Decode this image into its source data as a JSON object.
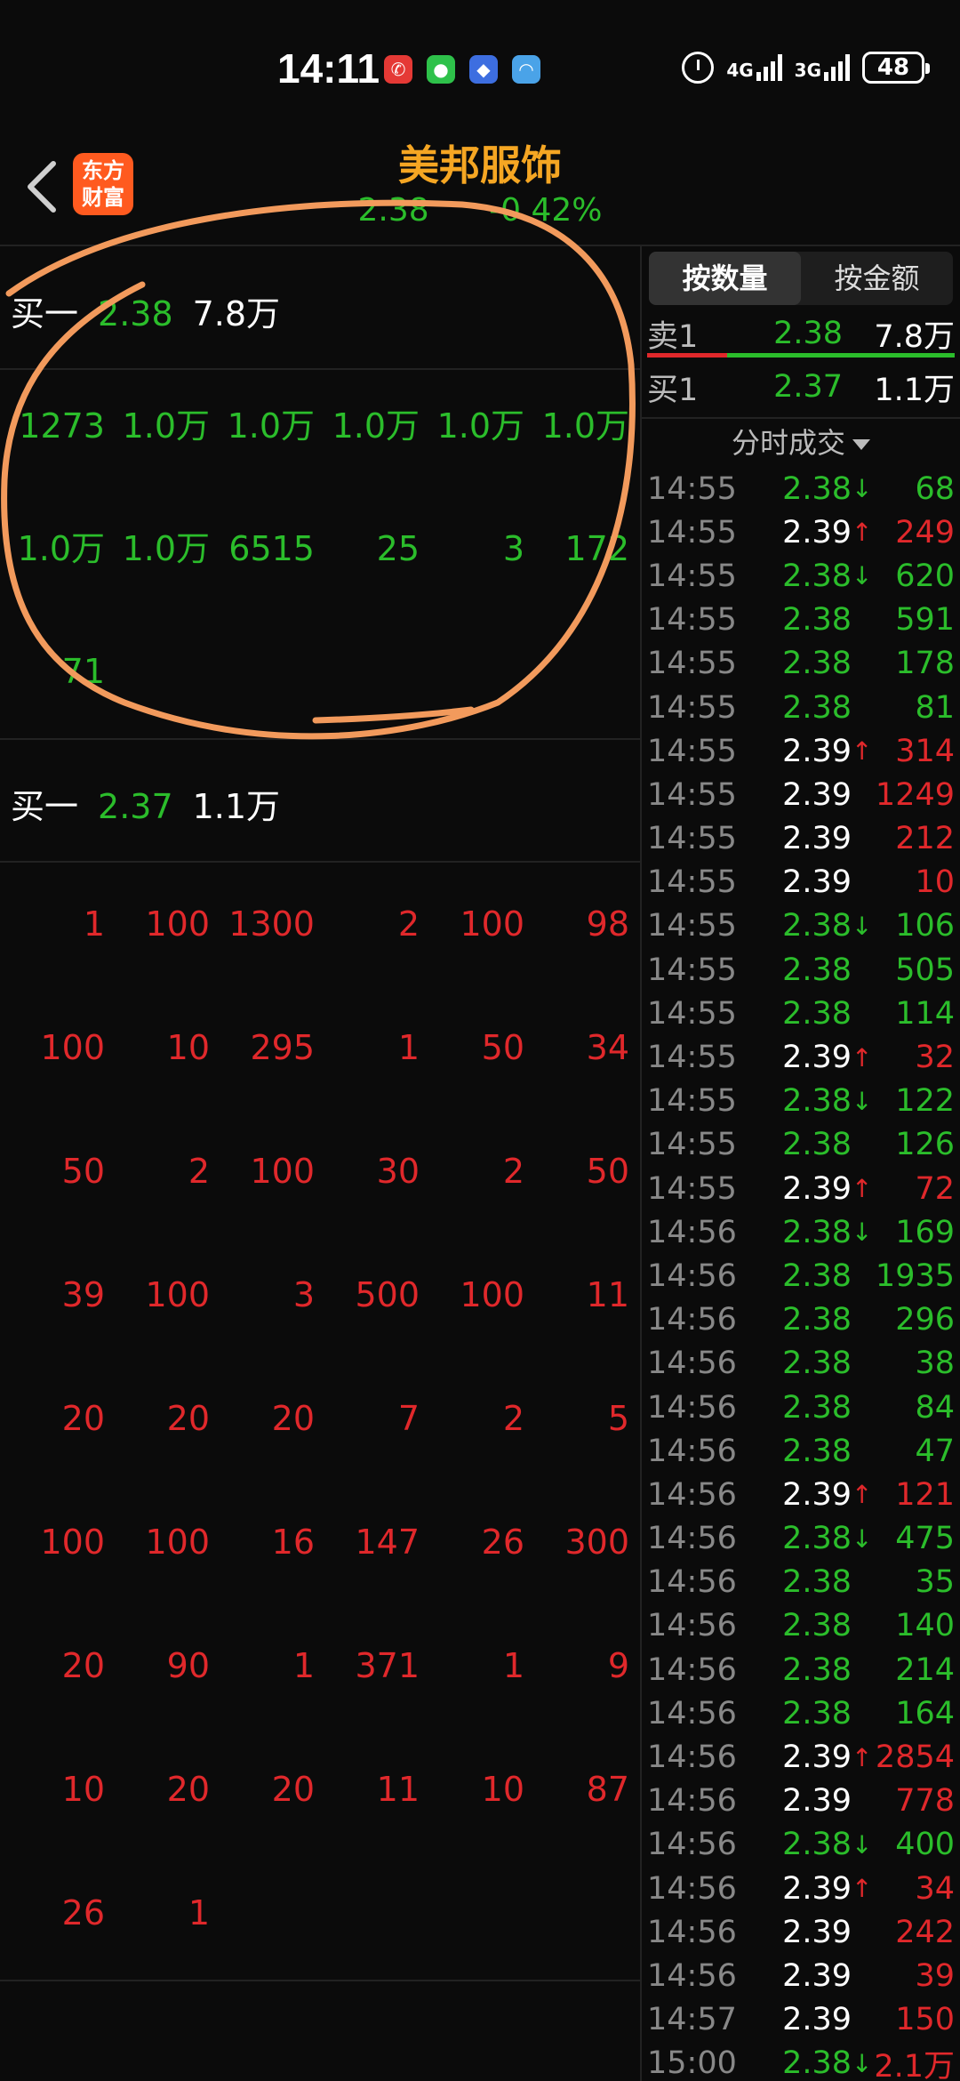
{
  "status_bar": {
    "time": "14:11",
    "network1": "4G",
    "network2": "3G",
    "battery": "48"
  },
  "header": {
    "logo_text": "东方财富",
    "title": "美邦服饰",
    "price": "2.38",
    "change_pct": "-0.42%"
  },
  "left_panel": {
    "buy_level_1": {
      "label": "买一",
      "price": "2.38",
      "volume": "7.8万"
    },
    "queue_1": [
      "1273",
      "1.0万",
      "1.0万",
      "1.0万",
      "1.0万",
      "1.0万",
      "1.0万",
      "1.0万",
      "6515",
      "25",
      "3",
      "172",
      "71"
    ],
    "buy_level_2": {
      "label": "买一",
      "price": "2.37",
      "volume": "1.1万"
    },
    "queue_2": [
      "1",
      "100",
      "1300",
      "2",
      "100",
      "98",
      "100",
      "10",
      "295",
      "1",
      "50",
      "34",
      "50",
      "2",
      "100",
      "30",
      "2",
      "50",
      "39",
      "100",
      "3",
      "500",
      "100",
      "11",
      "20",
      "20",
      "20",
      "7",
      "2",
      "5",
      "100",
      "100",
      "16",
      "147",
      "26",
      "300",
      "20",
      "90",
      "1",
      "371",
      "1",
      "9",
      "10",
      "20",
      "20",
      "11",
      "10",
      "87",
      "26",
      "1"
    ]
  },
  "right_panel": {
    "tabs": [
      {
        "label": "按数量",
        "active": true
      },
      {
        "label": "按金额",
        "active": false
      }
    ],
    "sell_row": {
      "label": "卖1",
      "price": "2.38",
      "volume": "7.8万"
    },
    "buy_row": {
      "label": "买1",
      "price": "2.37",
      "volume": "1.1万"
    },
    "section_title": "分时成交",
    "ticks": [
      {
        "time": "14:55",
        "price": "2.38",
        "arrow": "↓",
        "volume": "68",
        "pc": "green",
        "vc": "green"
      },
      {
        "time": "14:55",
        "price": "2.39",
        "arrow": "↑",
        "volume": "249",
        "pc": "white",
        "vc": "red"
      },
      {
        "time": "14:55",
        "price": "2.38",
        "arrow": "↓",
        "volume": "620",
        "pc": "green",
        "vc": "green"
      },
      {
        "time": "14:55",
        "price": "2.38",
        "arrow": "",
        "volume": "591",
        "pc": "green",
        "vc": "green"
      },
      {
        "time": "14:55",
        "price": "2.38",
        "arrow": "",
        "volume": "178",
        "pc": "green",
        "vc": "green"
      },
      {
        "time": "14:55",
        "price": "2.38",
        "arrow": "",
        "volume": "81",
        "pc": "green",
        "vc": "green"
      },
      {
        "time": "14:55",
        "price": "2.39",
        "arrow": "↑",
        "volume": "314",
        "pc": "white",
        "vc": "red"
      },
      {
        "time": "14:55",
        "price": "2.39",
        "arrow": "",
        "volume": "1249",
        "pc": "white",
        "vc": "red"
      },
      {
        "time": "14:55",
        "price": "2.39",
        "arrow": "",
        "volume": "212",
        "pc": "white",
        "vc": "red"
      },
      {
        "time": "14:55",
        "price": "2.39",
        "arrow": "",
        "volume": "10",
        "pc": "white",
        "vc": "red"
      },
      {
        "time": "14:55",
        "price": "2.38",
        "arrow": "↓",
        "volume": "106",
        "pc": "green",
        "vc": "green"
      },
      {
        "time": "14:55",
        "price": "2.38",
        "arrow": "",
        "volume": "505",
        "pc": "green",
        "vc": "green"
      },
      {
        "time": "14:55",
        "price": "2.38",
        "arrow": "",
        "volume": "114",
        "pc": "green",
        "vc": "green"
      },
      {
        "time": "14:55",
        "price": "2.39",
        "arrow": "↑",
        "volume": "32",
        "pc": "white",
        "vc": "red"
      },
      {
        "time": "14:55",
        "price": "2.38",
        "arrow": "↓",
        "volume": "122",
        "pc": "green",
        "vc": "green"
      },
      {
        "time": "14:55",
        "price": "2.38",
        "arrow": "",
        "volume": "126",
        "pc": "green",
        "vc": "green"
      },
      {
        "time": "14:55",
        "price": "2.39",
        "arrow": "↑",
        "volume": "72",
        "pc": "white",
        "vc": "red"
      },
      {
        "time": "14:56",
        "price": "2.38",
        "arrow": "↓",
        "volume": "169",
        "pc": "green",
        "vc": "green"
      },
      {
        "time": "14:56",
        "price": "2.38",
        "arrow": "",
        "volume": "1935",
        "pc": "green",
        "vc": "green"
      },
      {
        "time": "14:56",
        "price": "2.38",
        "arrow": "",
        "volume": "296",
        "pc": "green",
        "vc": "green"
      },
      {
        "time": "14:56",
        "price": "2.38",
        "arrow": "",
        "volume": "38",
        "pc": "green",
        "vc": "green"
      },
      {
        "time": "14:56",
        "price": "2.38",
        "arrow": "",
        "volume": "84",
        "pc": "green",
        "vc": "green"
      },
      {
        "time": "14:56",
        "price": "2.38",
        "arrow": "",
        "volume": "47",
        "pc": "green",
        "vc": "green"
      },
      {
        "time": "14:56",
        "price": "2.39",
        "arrow": "↑",
        "volume": "121",
        "pc": "white",
        "vc": "red"
      },
      {
        "time": "14:56",
        "price": "2.38",
        "arrow": "↓",
        "volume": "475",
        "pc": "green",
        "vc": "green"
      },
      {
        "time": "14:56",
        "price": "2.38",
        "arrow": "",
        "volume": "35",
        "pc": "green",
        "vc": "green"
      },
      {
        "time": "14:56",
        "price": "2.38",
        "arrow": "",
        "volume": "140",
        "pc": "green",
        "vc": "green"
      },
      {
        "time": "14:56",
        "price": "2.38",
        "arrow": "",
        "volume": "214",
        "pc": "green",
        "vc": "green"
      },
      {
        "time": "14:56",
        "price": "2.38",
        "arrow": "",
        "volume": "164",
        "pc": "green",
        "vc": "green"
      },
      {
        "time": "14:56",
        "price": "2.39",
        "arrow": "↑",
        "volume": "2854",
        "pc": "white",
        "vc": "red"
      },
      {
        "time": "14:56",
        "price": "2.39",
        "arrow": "",
        "volume": "778",
        "pc": "white",
        "vc": "red"
      },
      {
        "time": "14:56",
        "price": "2.38",
        "arrow": "↓",
        "volume": "400",
        "pc": "green",
        "vc": "green"
      },
      {
        "time": "14:56",
        "price": "2.39",
        "arrow": "↑",
        "volume": "34",
        "pc": "white",
        "vc": "red"
      },
      {
        "time": "14:56",
        "price": "2.39",
        "arrow": "",
        "volume": "242",
        "pc": "white",
        "vc": "red"
      },
      {
        "time": "14:56",
        "price": "2.39",
        "arrow": "",
        "volume": "39",
        "pc": "white",
        "vc": "red"
      },
      {
        "time": "14:57",
        "price": "2.39",
        "arrow": "",
        "volume": "150",
        "pc": "white",
        "vc": "red"
      },
      {
        "time": "15:00",
        "price": "2.38",
        "arrow": "↓",
        "volume": "2.1万",
        "pc": "green",
        "vc": "red"
      }
    ]
  },
  "colors": {
    "up": "#e0282b",
    "down": "#2bbd2b",
    "title": "#f5a623",
    "annotation": "#f29a5c"
  },
  "icons": [
    "back-arrow-icon",
    "alarm-icon",
    "signal-icon",
    "battery-icon"
  ]
}
